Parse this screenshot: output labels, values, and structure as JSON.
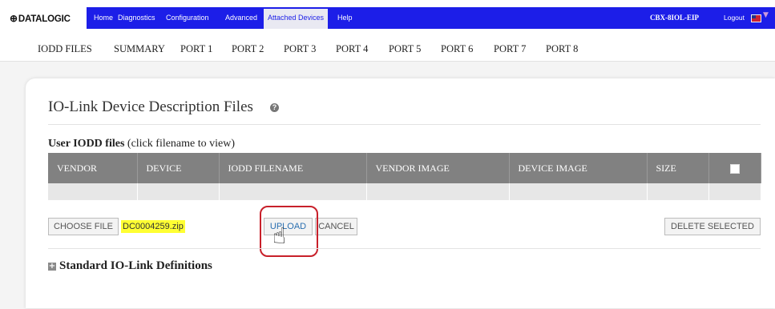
{
  "brand": {
    "logo_text": "DATALOGIC",
    "logo_mark": "⊕"
  },
  "nav": {
    "items": [
      {
        "label": "Home"
      },
      {
        "label": "Diagnostics"
      },
      {
        "label": "Configuration"
      },
      {
        "label": "Advanced"
      },
      {
        "label": "Attached Devices",
        "active": true
      },
      {
        "label": "Help"
      }
    ],
    "device_id": "CBX-8IOL-EIP",
    "logout_label": "Logout",
    "language_icon": "us-flag-icon",
    "color": "#1c1ee8"
  },
  "port_tabs": [
    "IODD FILES",
    "SUMMARY",
    "PORT 1",
    "PORT 2",
    "PORT 3",
    "PORT 4",
    "PORT 5",
    "PORT 6",
    "PORT 7",
    "PORT 8"
  ],
  "page": {
    "title": "IO-Link Device Description Files",
    "help_icon": "question-circle-icon"
  },
  "user_iodd": {
    "title_bold": "User IODD files",
    "title_hint": "(click filename to view)",
    "columns": [
      "VENDOR",
      "DEVICE",
      "IODD FILENAME",
      "VENDOR IMAGE",
      "DEVICE IMAGE",
      "SIZE"
    ],
    "select_all_checked": false,
    "rows": []
  },
  "upload": {
    "choose_file_label": "CHOOSE FILE",
    "selected_filename": "DC0004259.zip",
    "upload_label": "UPLOAD",
    "cancel_label": "CANCEL",
    "delete_selected_label": "DELETE SELECTED",
    "highlight_color": "#c8202a",
    "filename_highlight_color": "#ffff33"
  },
  "standard_defs": {
    "label": "Standard IO-Link Definitions",
    "expand_icon": "plus-square-icon",
    "expanded": false
  }
}
